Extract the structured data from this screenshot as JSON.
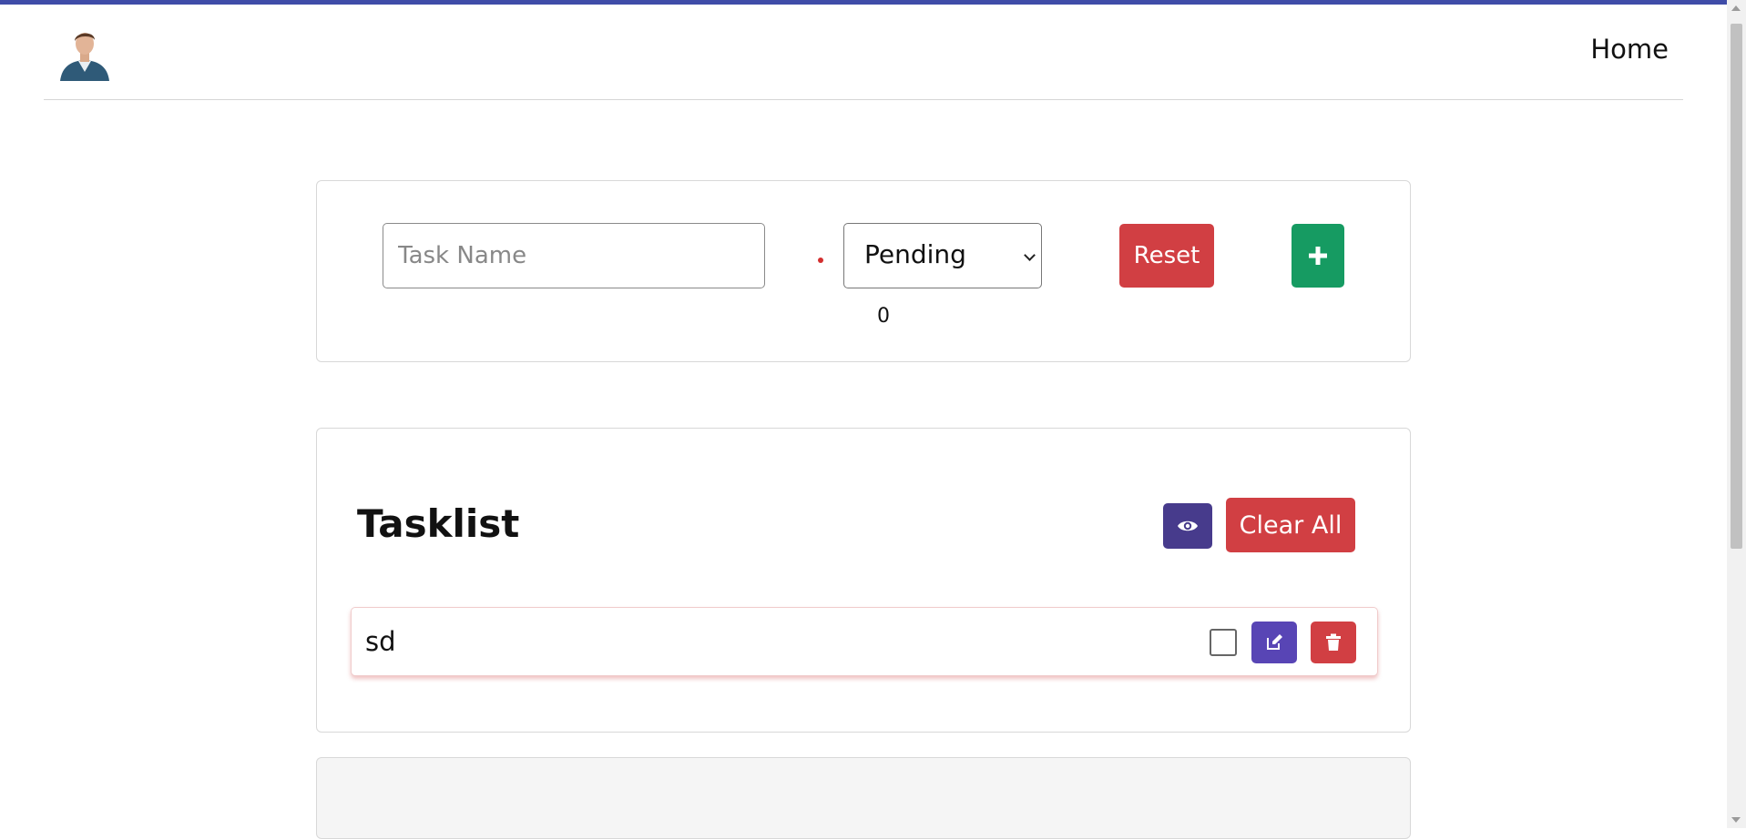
{
  "navbar": {
    "home_label": "Home"
  },
  "task_form": {
    "task_name_placeholder": "Task Name",
    "status_selected": "Pending",
    "counter": "0",
    "reset_label": "Reset"
  },
  "tasklist": {
    "title": "Tasklist",
    "clear_all_label": "Clear All",
    "tasks": [
      {
        "name": "sd",
        "completed": false
      }
    ]
  },
  "colors": {
    "top_line": "#3f4ca8",
    "danger": "#d13f43",
    "success": "#169b62",
    "primary": "#5845b5",
    "eye_button": "#473b8c"
  },
  "icons": {
    "add": "plus-icon",
    "eye": "eye-icon",
    "edit": "edit-icon",
    "delete": "trash-icon"
  }
}
